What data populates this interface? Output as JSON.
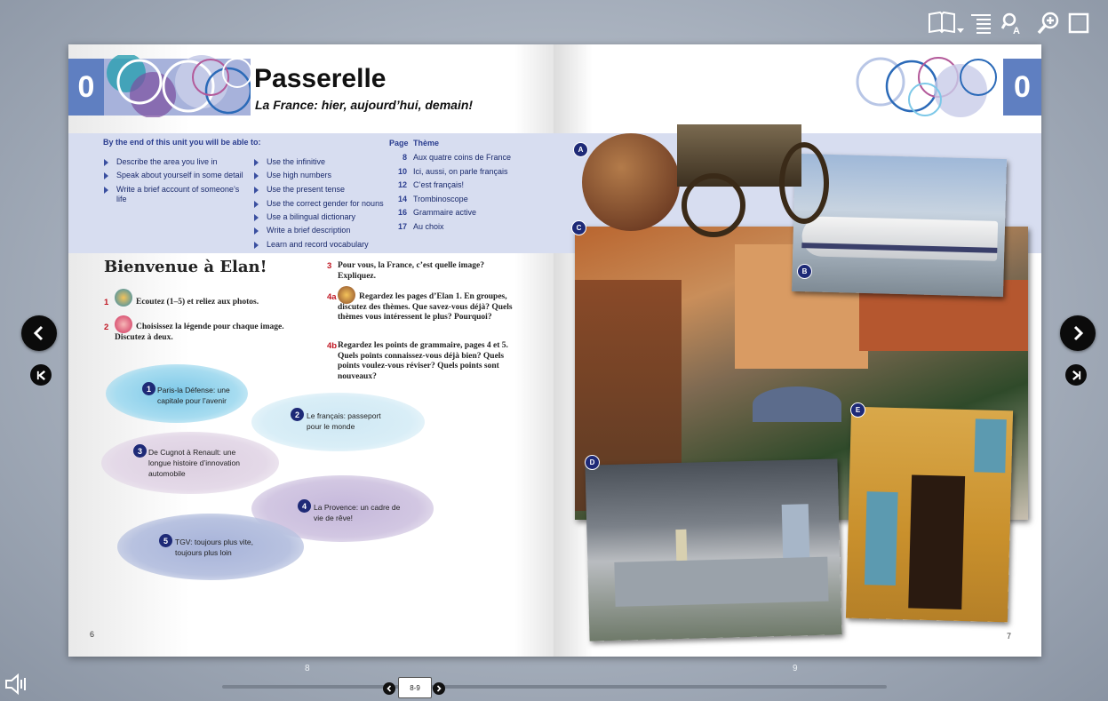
{
  "toolbar": {
    "icons": [
      "book-menu-icon",
      "table-of-contents-icon",
      "search-icon",
      "zoom-icon",
      "fullscreen-icon"
    ]
  },
  "left_page": {
    "unit_number": "0",
    "title": "Passerelle",
    "subtitle": "La France: hier, aujourd’hui, demain!",
    "objectives_heading": "By the end of this unit you will be able to:",
    "objectives_col1": [
      "Describe the area you live in",
      "Speak about yourself in some detail",
      "Write a brief account of someone’s life"
    ],
    "objectives_col2": [
      "Use the infinitive",
      "Use high numbers",
      "Use the present tense",
      "Use the correct gender for nouns",
      "Use a bilingual dictionary",
      "Write a brief description",
      "Learn and record vocabulary"
    ],
    "themes_header_page": "Page",
    "themes_header_theme": "Thème",
    "themes": [
      {
        "page": "8",
        "name": "Aux quatre coins de France"
      },
      {
        "page": "10",
        "name": "Ici, aussi, on parle français"
      },
      {
        "page": "12",
        "name": "C’est français!"
      },
      {
        "page": "14",
        "name": "Trombinoscope"
      },
      {
        "page": "16",
        "name": "Grammaire active"
      },
      {
        "page": "17",
        "name": "Au choix"
      }
    ],
    "heading": "Bienvenue à Elan!",
    "task1_num": "1",
    "task1": "Ecoutez (1–5) et reliez aux photos.",
    "task2_num": "2",
    "task2": "Choisissez la légende pour chaque image. Discutez à deux.",
    "task3_num": "3",
    "task3": "Pour vous, la France, c’est quelle image? Expliquez.",
    "task4a_num": "4a",
    "task4a": "Regardez les pages d’Elan 1. En groupes, discutez des thèmes. Que savez-vous déjà? Quels thèmes vous intéressent le plus? Pourquoi?",
    "task4b_num": "4b",
    "task4b": "Regardez les points de grammaire, pages 4 et 5. Quels points connaissez-vous déjà bien? Quels points voulez-vous réviser? Quels points sont nouveaux?",
    "bubbles": [
      {
        "num": "1",
        "text": "Paris-la Défense: une capitale pour l’avenir",
        "color": "#7cc8e8"
      },
      {
        "num": "2",
        "text": "Le français: passeport pour le monde",
        "color": "#b9def0"
      },
      {
        "num": "3",
        "text": "De Cugnot à Renault: une longue histoire d’innovation automobile",
        "color": "#d8c8dc"
      },
      {
        "num": "4",
        "text": "La Provence: un cadre de vie de rêve!",
        "color": "#c3b6da"
      },
      {
        "num": "5",
        "text": "TGV: toujours plus vite, toujours plus loin",
        "color": "#a7b3d9"
      }
    ],
    "page_number": "6"
  },
  "right_page": {
    "unit_number": "0",
    "photo_labels": [
      "A",
      "B",
      "C",
      "D",
      "E"
    ],
    "page_number": "7"
  },
  "footer": {
    "left_spread_page": "8",
    "right_spread_page": "9",
    "current_spread": "8-9"
  }
}
